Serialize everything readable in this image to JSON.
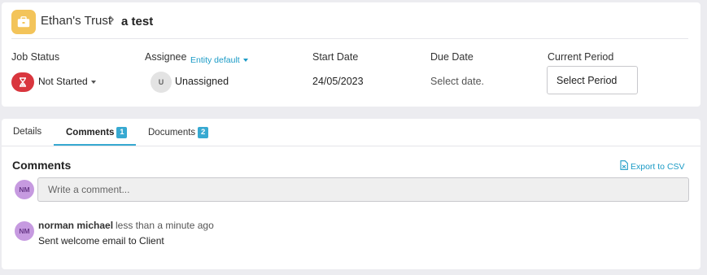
{
  "header": {
    "entity_name": "Ethan's Trust",
    "separator": ">",
    "job_name": "a test",
    "entity_icon": "briefcase-icon",
    "icon_bg": "#f3c45a"
  },
  "fields": {
    "job_status_label": "Job Status",
    "job_status_value": "Not Started",
    "status_color": "#d9363e",
    "assignee_label": "Assignee",
    "assignee_default": "Entity default",
    "assignee_initial": "U",
    "assignee_value": "Unassigned",
    "start_date_label": "Start Date",
    "start_date_value": "24/05/2023",
    "due_date_label": "Due Date",
    "due_date_value": "Select date.",
    "period_label": "Current Period",
    "period_button": "Select Period"
  },
  "tabs": [
    {
      "label": "Details",
      "badge": null,
      "active": false
    },
    {
      "label": "Comments",
      "badge": "1",
      "active": true
    },
    {
      "label": "Documents",
      "badge": "2",
      "active": false
    }
  ],
  "comments": {
    "title": "Comments",
    "export_label": "Export to CSV",
    "current_user_initials": "NM",
    "input_placeholder": "Write a comment...",
    "items": [
      {
        "initials": "NM",
        "author": "norman michael",
        "time": "less than a minute ago",
        "body": "Sent welcome email to Client"
      }
    ]
  },
  "colors": {
    "accent": "#37a9d1",
    "link": "#1b9bc6",
    "avatar_bg": "#c69ae0"
  }
}
